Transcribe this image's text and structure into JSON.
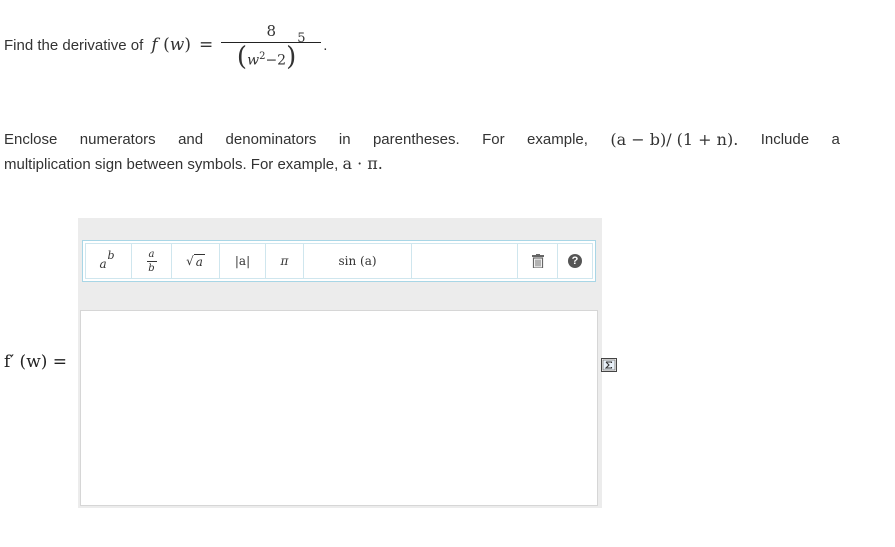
{
  "question": {
    "prefix": "Find the derivative of ",
    "function_name": "f",
    "variable": "w",
    "equals": "=",
    "numerator": "8",
    "base_var": "w",
    "base_exp": "2",
    "base_minus": "−2",
    "outer_exp": "5",
    "trailing": "."
  },
  "instructions": {
    "line1_words": [
      "Enclose",
      "numerators",
      "and",
      "denominators",
      "in",
      "parentheses.",
      "For",
      "example,"
    ],
    "example1": "(a − b)/ (1 + n).",
    "line1_tail": [
      "Include",
      "a"
    ],
    "line2_text": "multiplication sign between symbols. For example, ",
    "example2": "a · π."
  },
  "toolbar": {
    "power_base": "a",
    "power_exp": "b",
    "frac_num": "a",
    "frac_den": "b",
    "sqrt_arg": "a",
    "abs_label": "|a|",
    "pi_label": "π",
    "sin_label": "sin (a)",
    "help_label": "?",
    "icons": [
      "trash-icon",
      "help-icon",
      "formula-icon"
    ]
  },
  "answer": {
    "label": "f′ (w) =",
    "value": ""
  },
  "colors": {
    "toolbar_border": "#a8d6e6",
    "frame_bg": "#ececec",
    "text": "#333333"
  }
}
